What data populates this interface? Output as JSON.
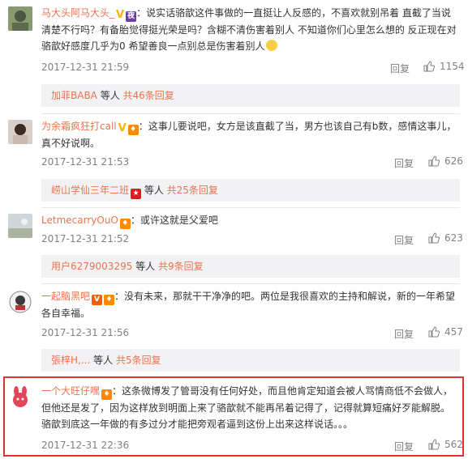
{
  "comments": [
    {
      "user": "马大头阿马大头_",
      "text": "说实话骆歆这件事做的一直挺让人反感的，不喜欢就别吊着 直截了当说清楚不行吗？有备胎觉得挺光荣是吗？含糊不清伤害着别人 不知道你们心里怎么想的 反正现在对骆歆好感度几乎为0 希望善良一点别总是伤害着别人",
      "time": "2017-12-31 21:59",
      "reply": "回复",
      "likes": "1154",
      "sub_user": "加菲BABA",
      "sub_mid": " 等人 ",
      "sub_count": "共46条回复"
    },
    {
      "user": "为余霜疯狂打call",
      "text": "这事儿要说吧，女方是该直截了当，男方也该自己有b数，感情这事儿，真不好说啊。",
      "time": "2017-12-31 21:53",
      "reply": "回复",
      "likes": "626",
      "sub_user": "崂山学仙三年二班",
      "sub_mid": " 等人 ",
      "sub_count": "共25条回复"
    },
    {
      "user": "LetmecarryOuO",
      "text": "或许这就是父爱吧",
      "time": "2017-12-31 21:52",
      "reply": "回复",
      "likes": "623",
      "sub_user": "用户6279003295",
      "sub_mid": " 等人 ",
      "sub_count": "共9条回复"
    },
    {
      "user": "一起脑黑吧",
      "text": "没有未来，那就干干净净的吧。两位是我很喜欢的主持和解说，新的一年希望各自幸福。",
      "time": "2017-12-31 21:56",
      "reply": "回复",
      "likes": "457",
      "sub_user": "張梓H,...",
      "sub_mid": " 等人 ",
      "sub_count": "共5条回复"
    },
    {
      "user": "一个大旺仔嘿",
      "text": "这条微博发了管哥没有任何好处，而且他肯定知道会被人骂情商低不会做人，但他还是发了，因为这样放到明面上来了骆歆就不能再吊着记得了，记得就算短痛好歹能解脱。骆歆到底这一年做的有多过分才能把旁观者逼到这份上出来这样说话。。。",
      "time": "2017-12-31 22:36",
      "reply": "回复",
      "likes": "562"
    }
  ],
  "colors": {
    "link": "#eb7350",
    "highlight": "#e03434",
    "sub_bg": "#f2f2f5"
  }
}
